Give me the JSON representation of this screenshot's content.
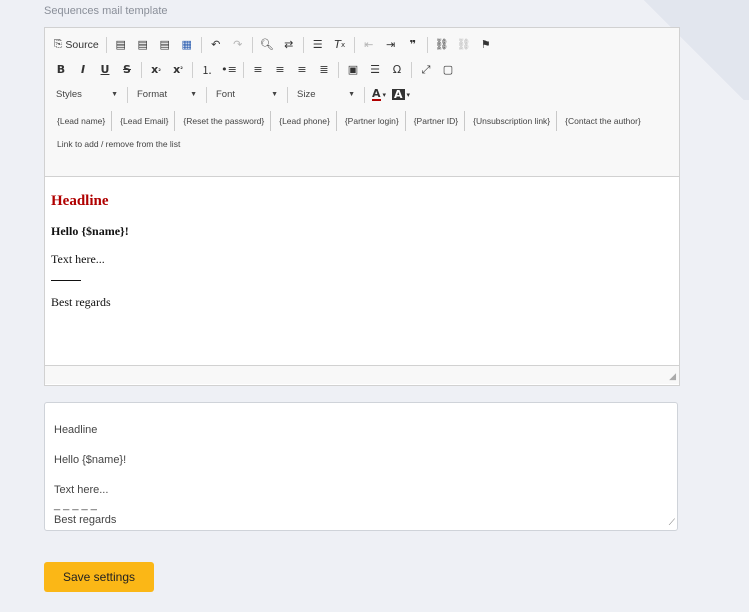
{
  "section_label": "Sequences mail template",
  "toolbar": {
    "source_label": "Source",
    "row1": [
      "📋",
      "📋",
      "📋",
      "▦"
    ],
    "styles_combo": "Styles",
    "format_combo": "Format",
    "font_combo": "Font",
    "size_combo": "Size"
  },
  "tags": [
    "{Lead name}",
    "{Lead Email}",
    "{Reset the password}",
    "{Lead phone}",
    "{Partner login}",
    "{Partner ID}",
    "{Unsubscription link}",
    "{Contact the author}"
  ],
  "link_row": "Link to add / remove from the list",
  "content": {
    "headline": "Headline",
    "hello": "Hello {$name}!",
    "text": "Text here...",
    "regards": "Best regards"
  },
  "plain_text": "Headline\n\nHello {$name}!\n\nText here...\n_ _ _ _ _\nBest regards",
  "save_button": "Save settings",
  "accent_color": "#fbb716",
  "headline_color": "#b00000"
}
